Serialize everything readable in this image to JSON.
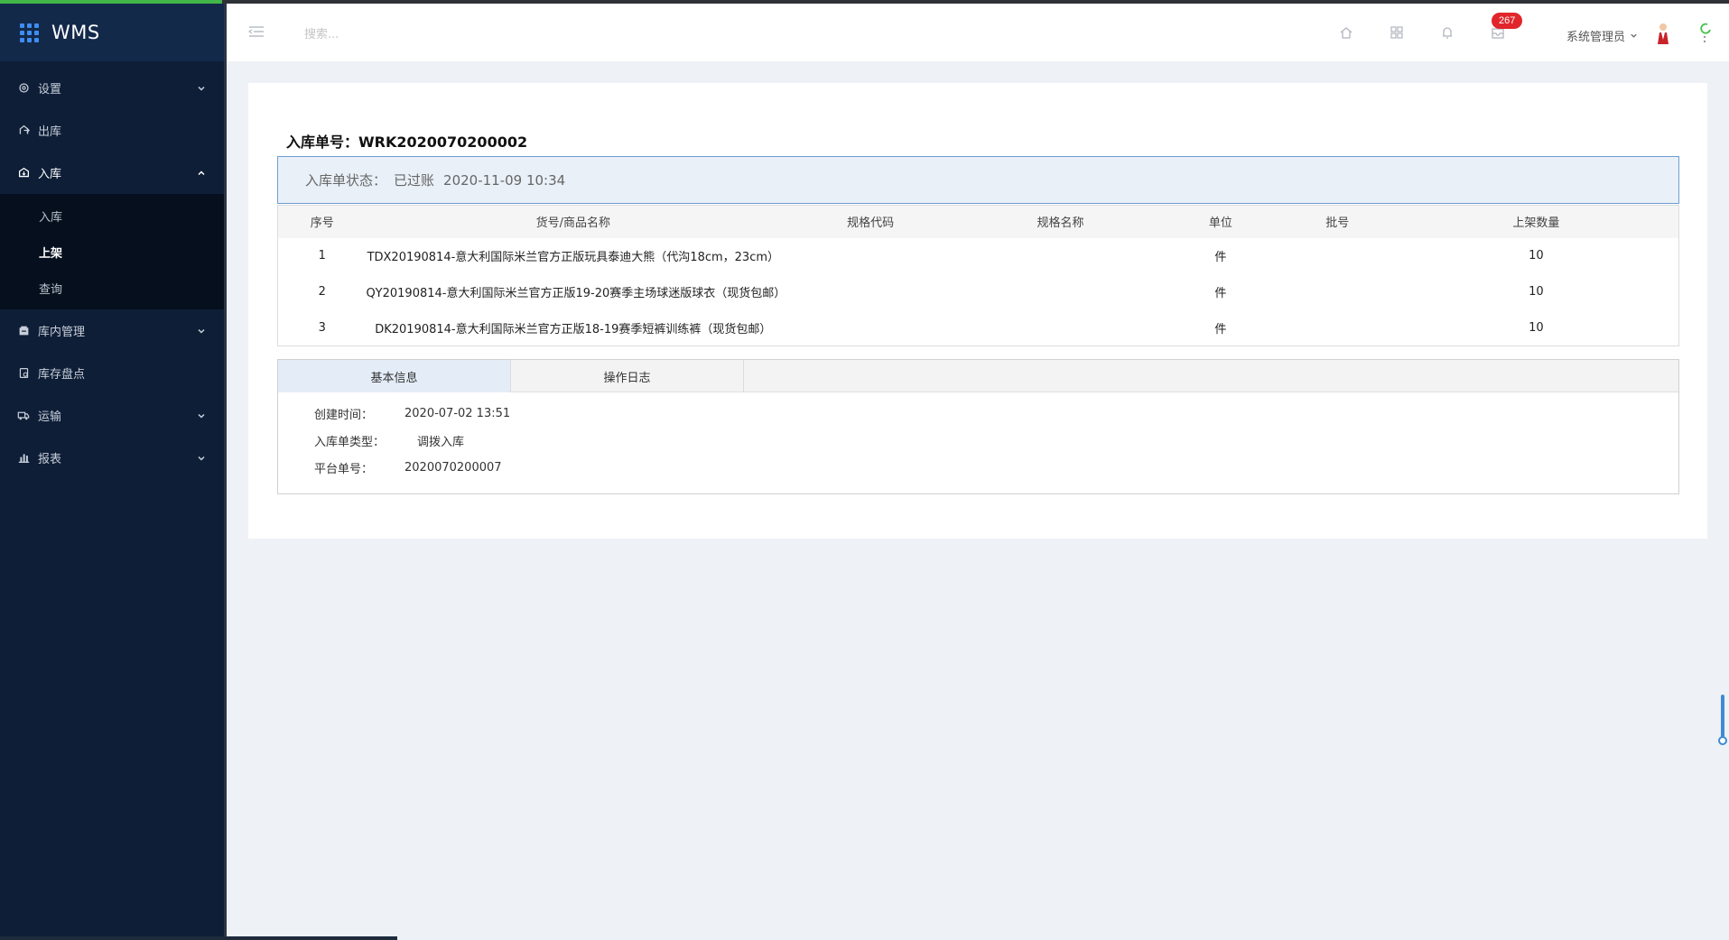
{
  "app": {
    "title": "WMS"
  },
  "sidebar": {
    "items": [
      {
        "label": "设置"
      },
      {
        "label": "出库"
      },
      {
        "label": "入库",
        "children": [
          {
            "label": "入库"
          },
          {
            "label": "上架"
          },
          {
            "label": "查询"
          }
        ]
      },
      {
        "label": "库内管理"
      },
      {
        "label": "库存盘点"
      },
      {
        "label": "运输"
      },
      {
        "label": "报表"
      }
    ]
  },
  "header": {
    "search_placeholder": "搜索...",
    "notification_count": "267",
    "user_name": "系统管理员"
  },
  "document": {
    "title": "入库单号：WRK2020070200002",
    "status_label": "入库单状态：",
    "status_value": "已过账",
    "status_time": "2020-11-09 10:34"
  },
  "items_table": {
    "columns": [
      "序号",
      "货号/商品名称",
      "规格代码",
      "规格名称",
      "单位",
      "批号",
      "上架数量"
    ],
    "rows": [
      [
        "1",
        "TDX20190814-意大利国际米兰官方正版玩具泰迪大熊（代沟18cm，23cm）",
        "",
        "",
        "件",
        "",
        "10"
      ],
      [
        "2",
        "QY20190814-意大利国际米兰官方正版19-20赛季主场球迷版球衣（现货包邮）",
        "",
        "",
        "件",
        "",
        "10"
      ],
      [
        "3",
        "DK20190814-意大利国际米兰官方正版18-19赛季短裤训练裤（现货包邮）",
        "",
        "",
        "件",
        "",
        "10"
      ]
    ]
  },
  "info_panel": {
    "tabs": [
      "基本信息",
      "操作日志"
    ],
    "fields": [
      {
        "label": "创建时间：",
        "value": "2020-07-02 13:51"
      },
      {
        "label": "入库单类型：",
        "value": "调拨入库"
      },
      {
        "label": "平台单号：",
        "value": "2020070200007"
      }
    ]
  },
  "colors": {
    "sidebar_bg": "#0e1e37",
    "accent": "#3d8ef0",
    "badge": "#e0262b",
    "status_bg": "#e9f0f8"
  }
}
